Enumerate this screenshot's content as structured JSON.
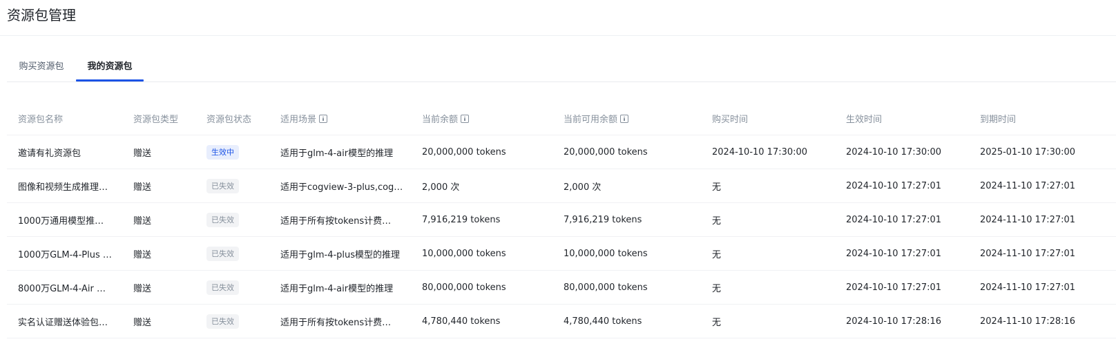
{
  "page": {
    "title": "资源包管理"
  },
  "tabs": [
    {
      "label": "购买资源包",
      "active": false
    },
    {
      "label": "我的资源包",
      "active": true
    }
  ],
  "colors": {
    "accent": "#1b53e6",
    "active_badge_bg": "#e8eefd",
    "expired_badge_bg": "#f2f3f5"
  },
  "table": {
    "columns": [
      "资源包名称",
      "资源包类型",
      "资源包状态",
      "适用场景",
      "当前余额",
      "当前可用余额",
      "购买时间",
      "生效时间",
      "到期时间"
    ],
    "rows": [
      {
        "name": "邀请有礼资源包",
        "type": "赠送",
        "status": "生效中",
        "status_kind": "active",
        "scene": "适用于glm-4-air模型的推理",
        "balance": "20,000,000 tokens",
        "available": "20,000,000 tokens",
        "purchase_time": "2024-10-10 17:30:00",
        "effective_time": "2024-10-10 17:30:00",
        "expire_time": "2025-01-10 17:30:00"
      },
      {
        "name": "图像和视频生成推理…",
        "type": "赠送",
        "status": "已失效",
        "status_kind": "expired",
        "scene": "适用于cogview-3-plus,cog…",
        "balance": "2,000 次",
        "available": "2,000 次",
        "purchase_time": "无",
        "effective_time": "2024-10-10 17:27:01",
        "expire_time": "2024-11-10 17:27:01"
      },
      {
        "name": "1000万通用模型推…",
        "type": "赠送",
        "status": "已失效",
        "status_kind": "expired",
        "scene": "适用于所有按tokens计费…",
        "balance": "7,916,219 tokens",
        "available": "7,916,219 tokens",
        "purchase_time": "无",
        "effective_time": "2024-10-10 17:27:01",
        "expire_time": "2024-11-10 17:27:01"
      },
      {
        "name": "1000万GLM-4-Plus …",
        "type": "赠送",
        "status": "已失效",
        "status_kind": "expired",
        "scene": "适用于glm-4-plus模型的推理",
        "balance": "10,000,000 tokens",
        "available": "10,000,000 tokens",
        "purchase_time": "无",
        "effective_time": "2024-10-10 17:27:01",
        "expire_time": "2024-11-10 17:27:01"
      },
      {
        "name": "8000万GLM-4-Air …",
        "type": "赠送",
        "status": "已失效",
        "status_kind": "expired",
        "scene": "适用于glm-4-air模型的推理",
        "balance": "80,000,000 tokens",
        "available": "80,000,000 tokens",
        "purchase_time": "无",
        "effective_time": "2024-10-10 17:27:01",
        "expire_time": "2024-11-10 17:27:01"
      },
      {
        "name": "实名认证赠送体验包…",
        "type": "赠送",
        "status": "已失效",
        "status_kind": "expired",
        "scene": "适用于所有按tokens计费…",
        "balance": "4,780,440 tokens",
        "available": "4,780,440 tokens",
        "purchase_time": "无",
        "effective_time": "2024-10-10 17:28:16",
        "expire_time": "2024-11-10 17:28:16"
      }
    ]
  }
}
